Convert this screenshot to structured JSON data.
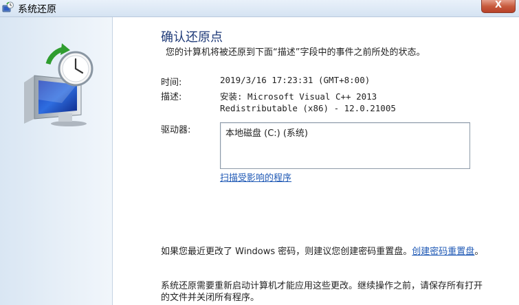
{
  "window": {
    "title": "系统还原",
    "close_label": "X"
  },
  "sidebar": {
    "icon": "system-restore-monitor-clock-icon"
  },
  "main": {
    "heading": "确认还原点",
    "subheading": "您的计算机将被还原到下面“描述”字段中的事件之前所处的状态。",
    "time_label": "时间:",
    "time_value": "2019/3/16 17:23:31 (GMT+8:00)",
    "desc_label": "描述:",
    "desc_line1": "安装: Microsoft Visual C++ 2013",
    "desc_line2": "Redistributable (x86) - 12.0.21005",
    "drives_label": "驱动器:",
    "drives": [
      "本地磁盘 (C:) (系统)"
    ],
    "scan_link": "扫描受影响的程序",
    "password_text": "如果您最近更改了 Windows 密码，则建议您创建密码重置盘。",
    "password_link": "创建密码重置盘",
    "password_end": "。",
    "restart_text": "系统还原需要重新启动计算机才能应用这些更改。继续操作之前，请保存所有打开的文件并关闭所有程序。"
  },
  "colors": {
    "heading": "#1e3a78",
    "link": "#1f59b5",
    "close": "#c75a3c"
  }
}
